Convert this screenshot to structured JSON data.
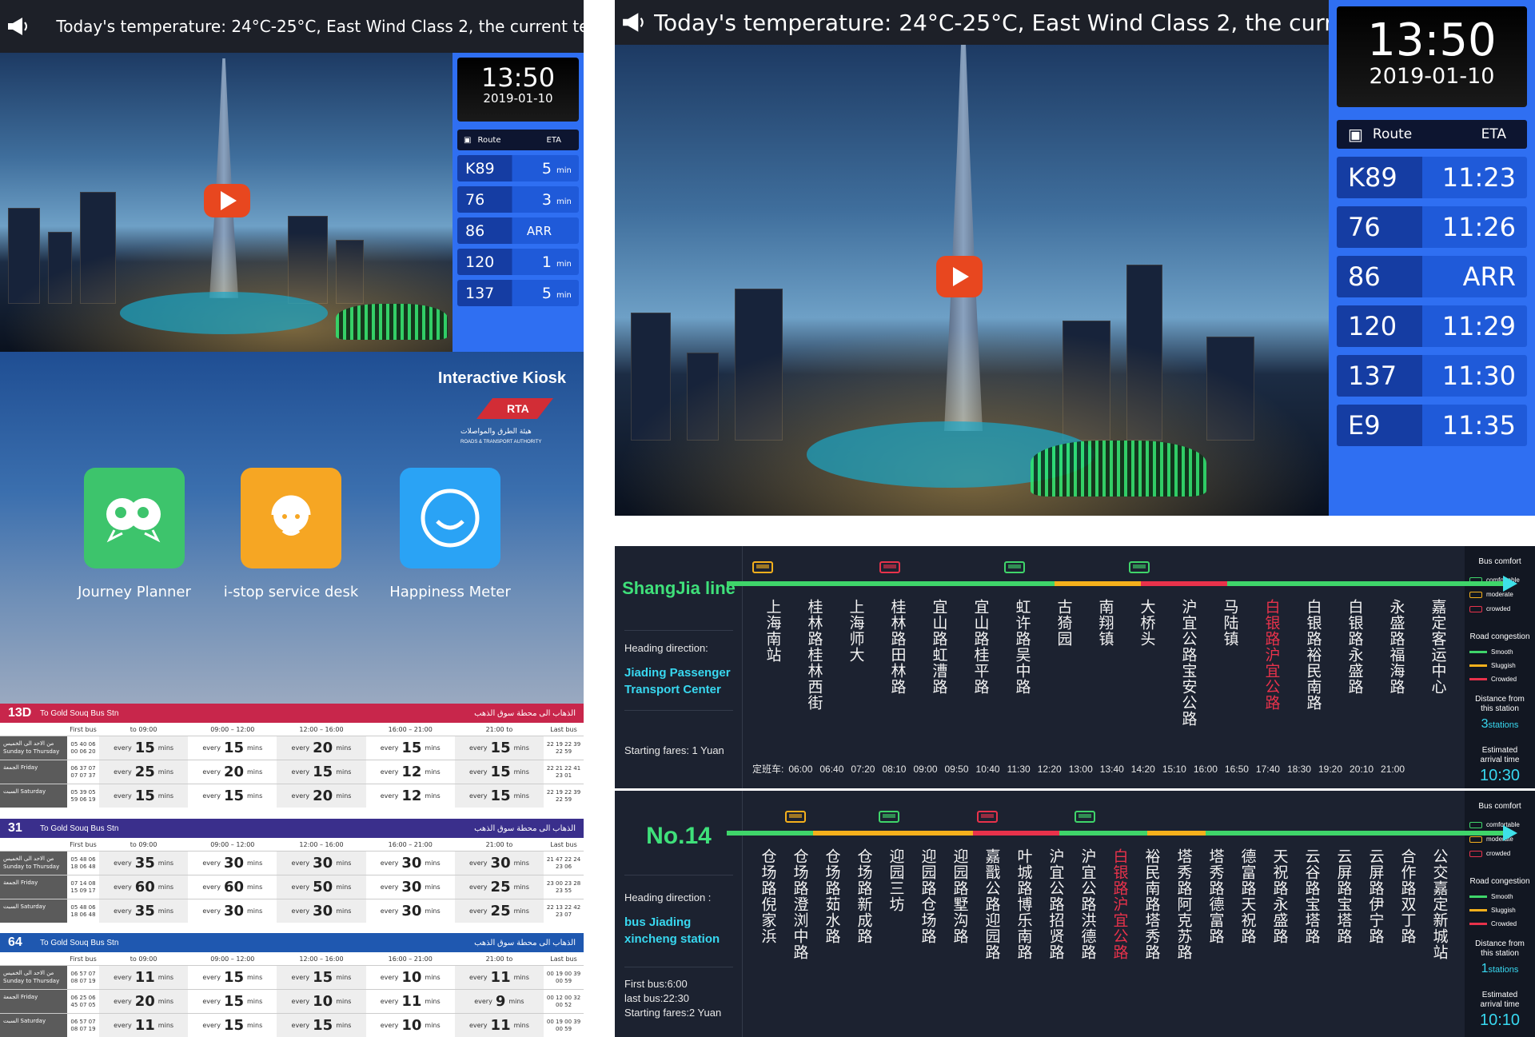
{
  "left_screen": {
    "ticker": "Today's temperature:  24°C-25°C, East Wind Class 2,  the current tempe",
    "clock": {
      "time": "13:50",
      "date": "2019-01-10"
    },
    "route_header": {
      "route": "Route",
      "eta": "ETA"
    },
    "routes": [
      {
        "route": "K89",
        "eta_value": "5",
        "eta_unit": "min"
      },
      {
        "route": "76",
        "eta_value": "3",
        "eta_unit": "min"
      },
      {
        "route": "86",
        "eta_value": "ARR",
        "eta_unit": ""
      },
      {
        "route": "120",
        "eta_value": "1",
        "eta_unit": "min"
      },
      {
        "route": "137",
        "eta_value": "5",
        "eta_unit": "min"
      }
    ],
    "kiosk": {
      "title": "Interactive Kiosk",
      "logo_text": "RTA",
      "logo_sub": "ROADS & TRANSPORT AUTHORITY",
      "apps": [
        {
          "label": "Journey Planner",
          "color": "#3dc46c"
        },
        {
          "label": "i-stop service desk",
          "color": "#f6a623"
        },
        {
          "label": "Happiness Meter",
          "color": "#2aa3f5"
        }
      ]
    },
    "timetables": [
      {
        "route": "13D",
        "to": "To Gold Souq Bus Stn",
        "arabic": "الذهاب الى محطة سوق الذهب",
        "color": "#c8264b",
        "headers": [
          "First bus",
          "to 09:00",
          "09:00 – 12:00",
          "12:00 – 16:00",
          "16:00 – 21:00",
          "21:00 to",
          "Last bus"
        ],
        "rows": [
          {
            "day": "من الاحد الى الخميس Sunday to Thursday",
            "first": "05 40 06 00 06 20",
            "vals": [
              "15",
              "15",
              "20",
              "15",
              "15"
            ],
            "last": "22 19 22 39 22 59"
          },
          {
            "day": "الجمعة Friday",
            "first": "06 37 07 07 07 37",
            "vals": [
              "25",
              "20",
              "15",
              "12",
              "15"
            ],
            "last": "22 21 22 41 23 01"
          },
          {
            "day": "السبت Saturday",
            "first": "05 39 05 59 06 19",
            "vals": [
              "15",
              "15",
              "20",
              "12",
              "15"
            ],
            "last": "22 19 22 39 22 59"
          }
        ]
      },
      {
        "route": "31",
        "to": "To Gold Souq Bus Stn",
        "arabic": "الذهاب الى محطة سوق الذهب",
        "color": "#3a2f8c",
        "headers": [
          "First bus",
          "to 09:00",
          "09:00 – 12:00",
          "12:00 – 16:00",
          "16:00 – 21:00",
          "21:00 to",
          "Last bus"
        ],
        "rows": [
          {
            "day": "من الاحد الى الخميس Sunday to Thursday",
            "first": "05 48 06 18 06 48",
            "vals": [
              "35",
              "30",
              "30",
              "30",
              "30"
            ],
            "last": "21 47 22 24 23 06"
          },
          {
            "day": "الجمعة Friday",
            "first": "07 14 08 15 09 17",
            "vals": [
              "60",
              "60",
              "50",
              "30",
              "25"
            ],
            "last": "23 00 23 28 23 55"
          },
          {
            "day": "السبت Saturday",
            "first": "05 48 06 18 06 48",
            "vals": [
              "35",
              "30",
              "30",
              "30",
              "25"
            ],
            "last": "22 13 22 42 23 07"
          }
        ]
      },
      {
        "route": "64",
        "to": "To Gold Souq Bus Stn",
        "arabic": "الذهاب الى محطة سوق الذهب",
        "color": "#1f58b0",
        "headers": [
          "First bus",
          "to 09:00",
          "09:00 – 12:00",
          "12:00 – 16:00",
          "16:00 – 21:00",
          "21:00 to",
          "Last bus"
        ],
        "rows": [
          {
            "day": "من الاحد الى الخميس Sunday to Thursday",
            "first": "06 57 07 08 07 19",
            "vals": [
              "11",
              "15",
              "15",
              "10",
              "11"
            ],
            "last": "00 19 00 39 00 59"
          },
          {
            "day": "الجمعة Friday",
            "first": "06 25 06 45 07 05",
            "vals": [
              "20",
              "15",
              "10",
              "11",
              "9"
            ],
            "last": "00 12 00 32 00 52"
          },
          {
            "day": "السبت Saturday",
            "first": "06 57 07 08 07 19",
            "vals": [
              "11",
              "15",
              "15",
              "10",
              "11"
            ],
            "last": "00 19 00 39 00 59"
          }
        ]
      }
    ],
    "tt_words": {
      "every": "every",
      "mins": "mins"
    }
  },
  "right_screen": {
    "ticker": "Today's temperature:  24°C-25°C, East Wind Class 2,  the curre",
    "clock": {
      "time": "13:50",
      "date": "2019-01-10"
    },
    "route_header": {
      "route": "Route",
      "eta": "ETA"
    },
    "routes": [
      {
        "route": "K89",
        "eta": "11:23"
      },
      {
        "route": "76",
        "eta": "11:26"
      },
      {
        "route": "86",
        "eta": "ARR"
      },
      {
        "route": "120",
        "eta": "11:29"
      },
      {
        "route": "137",
        "eta": "11:30"
      },
      {
        "route": "E9",
        "eta": "11:35"
      }
    ]
  },
  "line1": {
    "name": "ShangJia line",
    "heading_label": "Heading direction:",
    "destination_line1": "Jiading Passenger",
    "destination_line2": "Transport Center",
    "fares": "Starting fares: 1 Yuan",
    "stations": [
      "上海南站",
      "桂林路桂林西街",
      "上海师大",
      "桂林路田林路",
      "宜山路虹漕路",
      "宜山路桂平路",
      "虹许路吴中路",
      "古猗园",
      "南翔镇",
      "大桥头",
      "沪宜公路宝安公路",
      "马陆镇",
      "白银路沪宜公路",
      "白银路裕民南路",
      "白银路永盛路",
      "永盛路福海路",
      "嘉定客运中心"
    ],
    "highlight_index": 12,
    "times_label": "定班车:",
    "times": [
      "06:00",
      "06:40",
      "07:20",
      "08:10",
      "09:00",
      "09:50",
      "10:40",
      "11:30",
      "12:20",
      "13:00",
      "13:40",
      "14:20",
      "15:10",
      "16:00",
      "16:50",
      "17:40",
      "18:30",
      "19:20",
      "20:10",
      "21:00"
    ]
  },
  "line2": {
    "name": "No.14",
    "heading_label": "Heading direction :",
    "destination_line1": "bus Jiading",
    "destination_line2": "xincheng station",
    "first_bus": "First bus:6:00",
    "last_bus": "last bus:22:30",
    "fares": "Starting fares:2 Yuan",
    "stations": [
      "仓场路倪家浜",
      "仓场路澄浏中路",
      "仓场路茹水路",
      "仓场路新成路",
      "迎园三坊",
      "迎园路仓场路",
      "迎园路墅沟路",
      "嘉戬公路迎园路",
      "叶城路博乐南路",
      "沪宜公路招贤路",
      "沪宜公路洪德路",
      "白银路沪宜公路",
      "裕民南路塔秀路",
      "塔秀路阿克苏路",
      "塔秀路德富路",
      "德富路天祝路",
      "天祝路永盛路",
      "云谷路宝塔路",
      "云屏路宝塔路",
      "云屏路伊宁路",
      "合作路双丁路",
      "公交嘉定新城站"
    ],
    "highlight_index": 11
  },
  "legend": {
    "comfort_title": "Bus comfort",
    "comfort_items": [
      "comfortable",
      "moderate",
      "crowded"
    ],
    "congestion_title": "Road congestion",
    "congestion_items": [
      "Smooth",
      "Sluggish",
      "Crowded"
    ],
    "distance_title_1": "Distance from",
    "distance_title_2": "this station",
    "eta_title_1": "Estimated",
    "eta_title_2": "arrival time",
    "line1_stations": "3",
    "line1_eta": "10:30",
    "line2_stations": "1",
    "line2_eta": "10:10",
    "stations_word": "stations"
  },
  "colors": {
    "green": "#3fd56a",
    "amber": "#f5b01c",
    "red": "#e8324b",
    "cyan": "#38d8f0",
    "board_blue": "#2f6ff2"
  }
}
